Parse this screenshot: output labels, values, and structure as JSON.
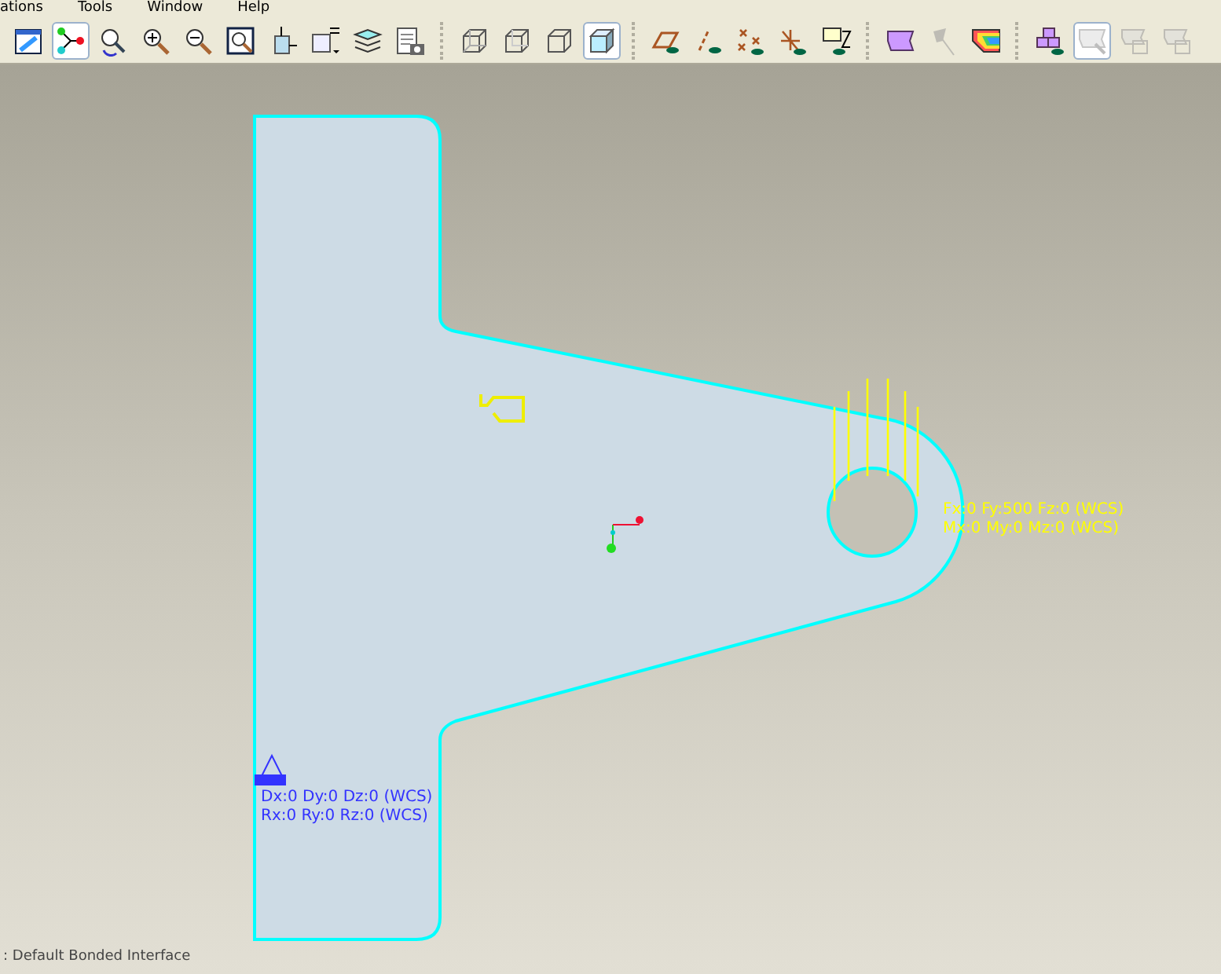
{
  "menu_bar": [
    "ations",
    "Tools",
    "Window",
    "Help"
  ],
  "toolbar": {
    "groups": [
      [
        {
          "selected": false,
          "disabled": false
        },
        {
          "selected": true,
          "disabled": false
        },
        {
          "selected": false,
          "disabled": false
        },
        {
          "selected": false,
          "disabled": false
        },
        {
          "selected": false,
          "disabled": false
        },
        {
          "selected": false,
          "disabled": false
        },
        {
          "selected": false,
          "disabled": false
        },
        {
          "selected": false,
          "disabled": false
        },
        {
          "selected": false,
          "disabled": false
        },
        {
          "selected": false,
          "disabled": false
        }
      ],
      [
        {
          "selected": false,
          "disabled": false
        },
        {
          "selected": false,
          "disabled": false
        },
        {
          "selected": false,
          "disabled": false
        },
        {
          "selected": true,
          "disabled": false
        }
      ],
      [
        {
          "selected": false,
          "disabled": false
        },
        {
          "selected": false,
          "disabled": false
        },
        {
          "selected": false,
          "disabled": false
        },
        {
          "selected": false,
          "disabled": false
        },
        {
          "selected": false,
          "disabled": false
        }
      ],
      [
        {
          "selected": false,
          "disabled": false
        },
        {
          "selected": false,
          "disabled": true
        },
        {
          "selected": false,
          "disabled": false
        }
      ],
      [
        {
          "selected": false,
          "disabled": false
        },
        {
          "selected": true,
          "disabled": true
        },
        {
          "selected": false,
          "disabled": true
        },
        {
          "selected": false,
          "disabled": true
        }
      ]
    ]
  },
  "canvas": {
    "load_label": [
      "Fx:0 Fy:500 Fz:0 (WCS)",
      "Mx:0 My:0 Mz:0 (WCS)"
    ],
    "constraint_label": [
      "Dx:0 Dy:0 Dz:0 (WCS)",
      "Rx:0 Ry:0 Rz:0 (WCS)"
    ]
  },
  "status_bar": ": Default Bonded Interface"
}
